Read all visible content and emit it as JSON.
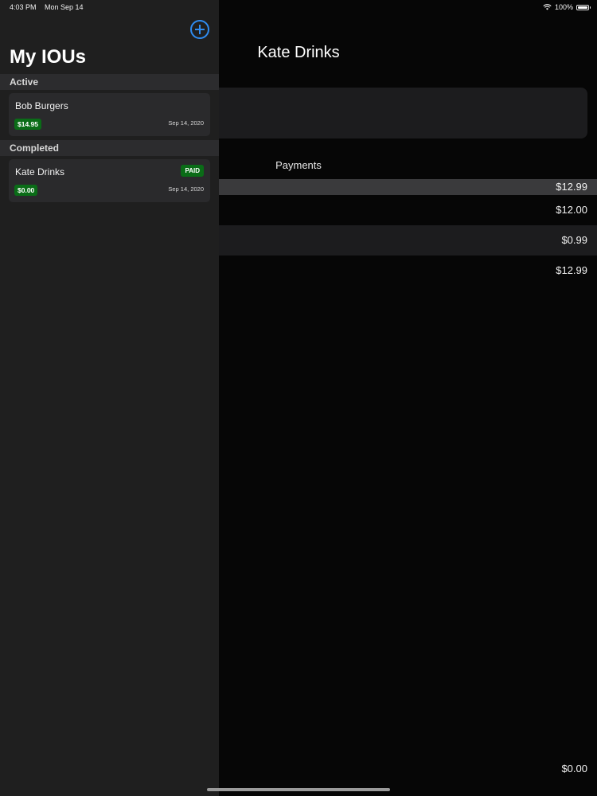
{
  "status": {
    "time": "4:03 PM",
    "date": "Mon Sep 14",
    "battery": "100%"
  },
  "sidebar": {
    "title": "My IOUs",
    "sections": {
      "active": {
        "header": "Active",
        "items": [
          {
            "name": "Bob Burgers",
            "amount": "$14.95",
            "date": "Sep 14, 2020"
          }
        ]
      },
      "completed": {
        "header": "Completed",
        "items": [
          {
            "name": "Kate Drinks",
            "amount": "$0.00",
            "date": "Sep 14, 2020",
            "badge": "PAID"
          }
        ]
      }
    }
  },
  "detail": {
    "title": "Kate Drinks",
    "payments_label": "Payments",
    "payments": [
      "$12.99",
      "$12.00",
      "$0.99",
      "$12.99"
    ],
    "footer_total": "$0.00"
  },
  "colors": {
    "accent": "#2f8cf0",
    "badge_green": "#0a6c17",
    "sidebar_bg": "#1f1f1f",
    "card_bg": "#2a2a2c"
  },
  "icons": {
    "add": "plus-circle-icon",
    "wifi": "wifi-icon",
    "battery": "battery-icon"
  }
}
